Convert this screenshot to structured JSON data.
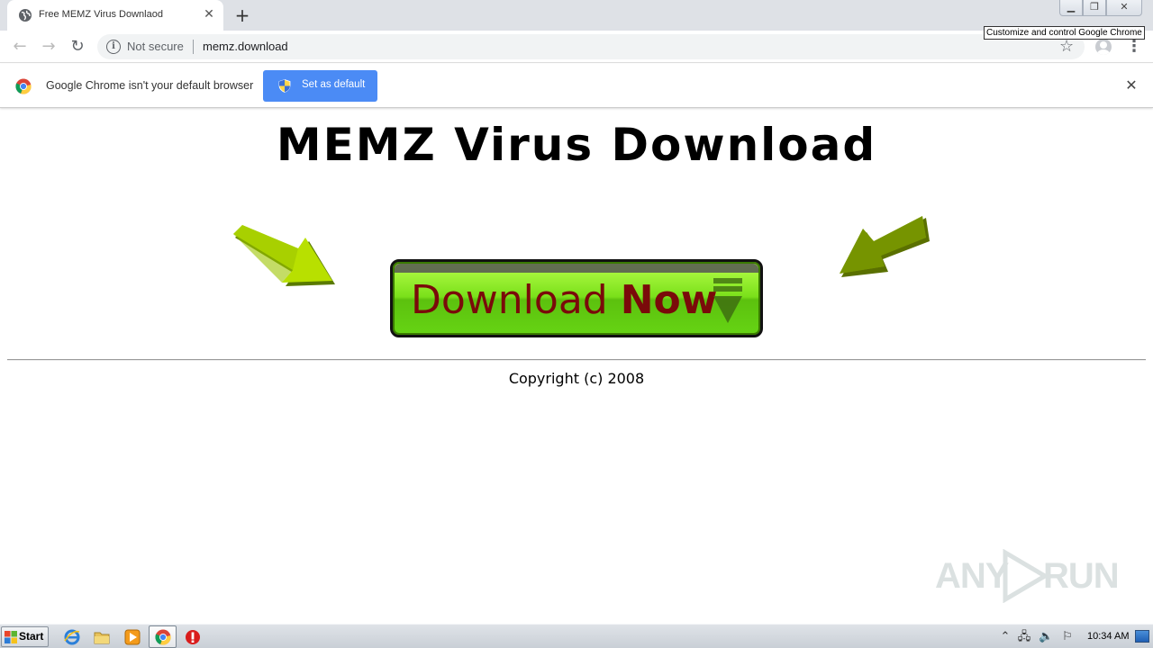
{
  "browser": {
    "tab_title": "Free MEMZ Virus Downlaod",
    "new_tab_symbol": "+",
    "security_label": "Not secure",
    "url": "memz.download",
    "tooltip": "Customize and control Google Chrome"
  },
  "infobar": {
    "message": "Google Chrome isn't your default browser",
    "button_label": "Set as default"
  },
  "page": {
    "title": "MEMZ Virus Download",
    "download_word1": "Download",
    "download_word2": "Now",
    "copyright": "Copyright (c) 2008"
  },
  "watermark": {
    "left": "ANY",
    "right": "RUN"
  },
  "taskbar": {
    "start_label": "Start",
    "clock": "10:34 AM"
  },
  "colors": {
    "button_green": "#7ae01a",
    "button_text": "#7a0a0a",
    "arrow_green": "#a6d40a",
    "chrome_blue": "#4b8bf5"
  },
  "icons": [
    "globe-icon",
    "close-icon",
    "plus-icon",
    "back-icon",
    "forward-icon",
    "reload-icon",
    "info-icon",
    "star-icon",
    "profile-icon",
    "menu-icon",
    "chrome-logo-icon",
    "shield-icon",
    "arrow-icon",
    "download-arrow-icon",
    "windows-logo-icon",
    "ie-icon",
    "folder-icon",
    "media-player-icon",
    "chrome-icon",
    "stop-icon",
    "flag-icon",
    "volume-icon",
    "network-icon"
  ]
}
